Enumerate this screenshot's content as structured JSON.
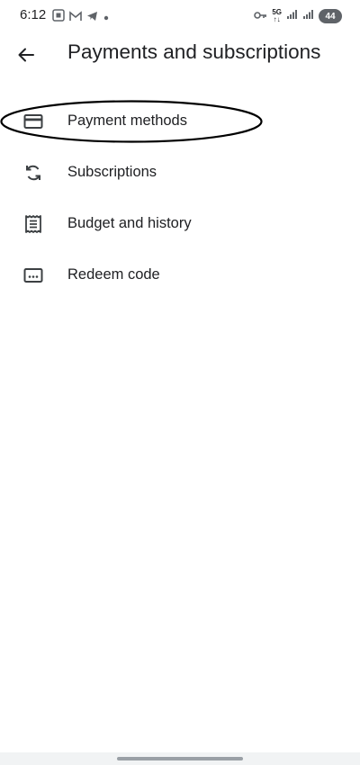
{
  "status_bar": {
    "time": "6:12",
    "network_top": "5G",
    "network_bottom": "↑↓",
    "battery": "44"
  },
  "header": {
    "title": "Payments and subscriptions",
    "back_icon": "arrow-back-icon"
  },
  "menu": {
    "items": [
      {
        "label": "Payment methods",
        "icon": "credit-card-icon"
      },
      {
        "label": "Subscriptions",
        "icon": "sync-icon"
      },
      {
        "label": "Budget and history",
        "icon": "receipt-icon"
      },
      {
        "label": "Redeem code",
        "icon": "redeem-code-icon"
      }
    ]
  },
  "annotation": {
    "highlighted_item": "Payment methods"
  }
}
